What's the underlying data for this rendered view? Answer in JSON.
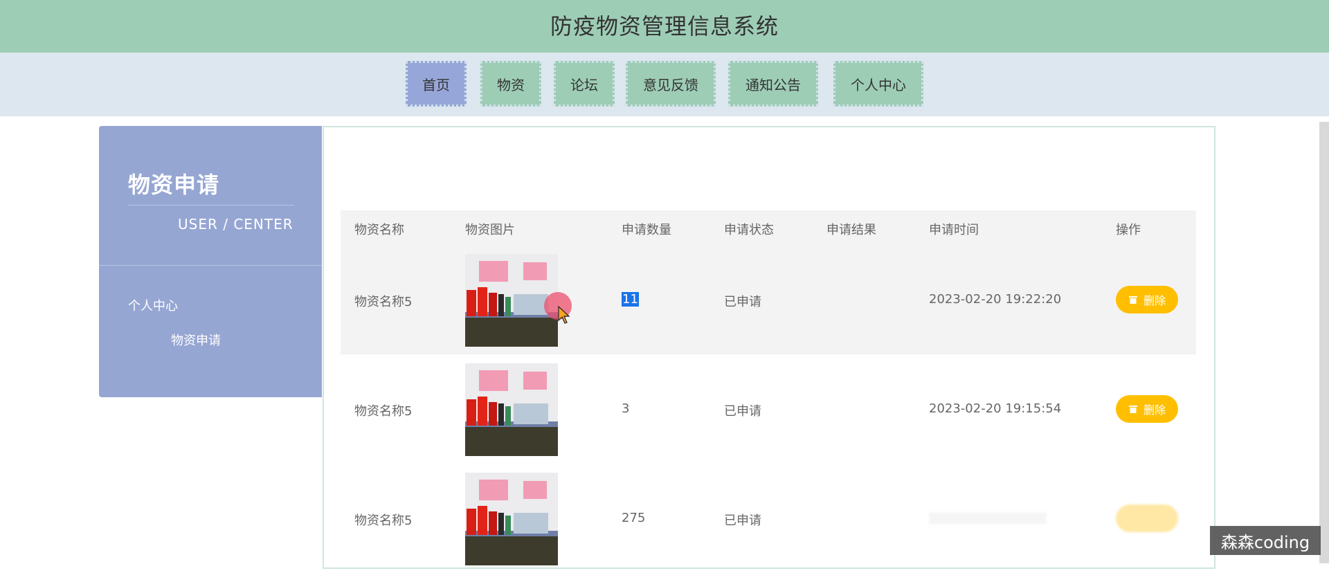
{
  "header": {
    "title": "防疫物资管理信息系统"
  },
  "nav": {
    "items": [
      {
        "label": "首页",
        "active": true
      },
      {
        "label": "物资"
      },
      {
        "label": "论坛"
      },
      {
        "label": "意见反馈"
      },
      {
        "label": "通知公告"
      },
      {
        "label": "个人中心"
      }
    ]
  },
  "sidebar": {
    "title": "物资申请",
    "subtitle": "USER / CENTER",
    "menu": [
      {
        "label": "个人中心"
      },
      {
        "label": "物资申请"
      }
    ]
  },
  "table": {
    "columns": [
      "物资名称",
      "物资图片",
      "申请数量",
      "申请状态",
      "申请结果",
      "申请时间",
      "操作"
    ],
    "rows": [
      {
        "name": "物资名称5",
        "quantity": "11",
        "status": "已申请",
        "result": "",
        "time": "2023-02-20 19:22:20",
        "action": "删除"
      },
      {
        "name": "物资名称5",
        "quantity": "3",
        "status": "已申请",
        "result": "",
        "time": "2023-02-20 19:15:54",
        "action": "删除"
      },
      {
        "name": "物资名称5",
        "quantity": "275",
        "status": "已申请",
        "result": "",
        "time": "",
        "action": ""
      }
    ]
  },
  "icons": {
    "delete": "trash-icon"
  },
  "colors": {
    "header": "#9ecdb6",
    "nav_bg": "#dde7f0",
    "nav_active": "#97a6d8",
    "sidebar": "#96a6d3",
    "delete_button": "#ffbf00"
  },
  "watermark": "森森coding"
}
